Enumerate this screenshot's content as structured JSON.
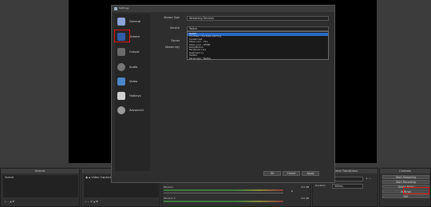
{
  "settings": {
    "title": "Settings",
    "sidebar": [
      {
        "label": "General",
        "icon": "general-icon",
        "color": "#8aa2d8"
      },
      {
        "label": "Stream",
        "icon": "stream-icon",
        "color": "#2f5ca8"
      },
      {
        "label": "Output",
        "icon": "output-icon",
        "color": "#6a6a6a"
      },
      {
        "label": "Audio",
        "icon": "audio-icon",
        "color": "#777777"
      },
      {
        "label": "Video",
        "icon": "video-icon",
        "color": "#4a86c8"
      },
      {
        "label": "Hotkeys",
        "icon": "hotkeys-icon",
        "color": "#d0d0d0"
      },
      {
        "label": "Advanced",
        "icon": "advanced-icon",
        "color": "#9a9a9a"
      }
    ],
    "stream_type_label": "Stream Type",
    "stream_type_value": "Streaming Services",
    "service_label": "Service",
    "service_value": "Twitch",
    "server_label": "Server",
    "stream_key_label": "Stream key",
    "dropdown_items": [
      "Twitch",
      "YouTube / YouTube Gaming",
      "Smashcast",
      "Mixer.com - FTL",
      "Mixer.com - RTMP",
      "DailyMotion",
      "Facebook Live",
      "Restream.io",
      "Twitter",
      "Periscope / Twitter"
    ],
    "buttons": {
      "ok": "OK",
      "cancel": "Cancel",
      "apply": "Apply"
    }
  },
  "main": {
    "docks": {
      "scenes": "Scenes",
      "sources": "Sources",
      "mixer": "Audio Mixer",
      "transitions": "Scene Transitions",
      "controls": "Controls"
    },
    "scene_item": "Scene",
    "source_item": "Video Capture Device",
    "mixer_tracks": [
      {
        "name": "Desktop Audio",
        "db": "0.0 dB"
      },
      {
        "name": "Mic/Aux",
        "db": "0.0 dB"
      },
      {
        "name": "Mic/Aux 2",
        "db": "0.0 dB"
      }
    ],
    "transition_value": "Fade",
    "duration_label": "Duration",
    "duration_value": "300ms",
    "controls": [
      "Start Streaming",
      "Start Recording",
      "Studio Mode",
      "Settings",
      "Exit"
    ]
  },
  "colors": {
    "selection": "#2a6bc8",
    "highlight_border": "#dd1111"
  }
}
